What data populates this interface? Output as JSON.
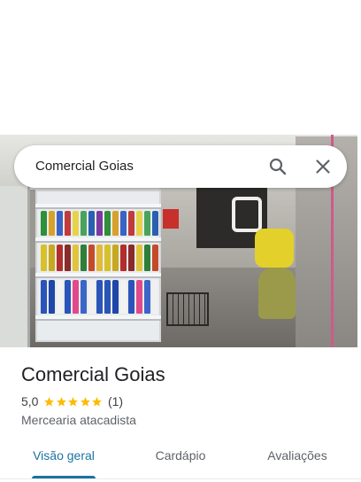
{
  "search": {
    "query": "Comercial Goias",
    "search_icon": "search-icon",
    "close_icon": "close-icon"
  },
  "place": {
    "title": "Comercial Goias",
    "rating_text": "5,0",
    "rating_value": 5.0,
    "stars_max": 5,
    "review_count_text": "(1)",
    "category": "Mercearia atacadista"
  },
  "tabs": [
    {
      "label": "Visão geral",
      "active": true
    },
    {
      "label": "Cardápio",
      "active": false
    },
    {
      "label": "Avaliações",
      "active": false
    }
  ],
  "colors": {
    "accent": "#1a73a0",
    "star": "#fbbc04",
    "text_primary": "#202124",
    "text_secondary": "#5f6368"
  }
}
